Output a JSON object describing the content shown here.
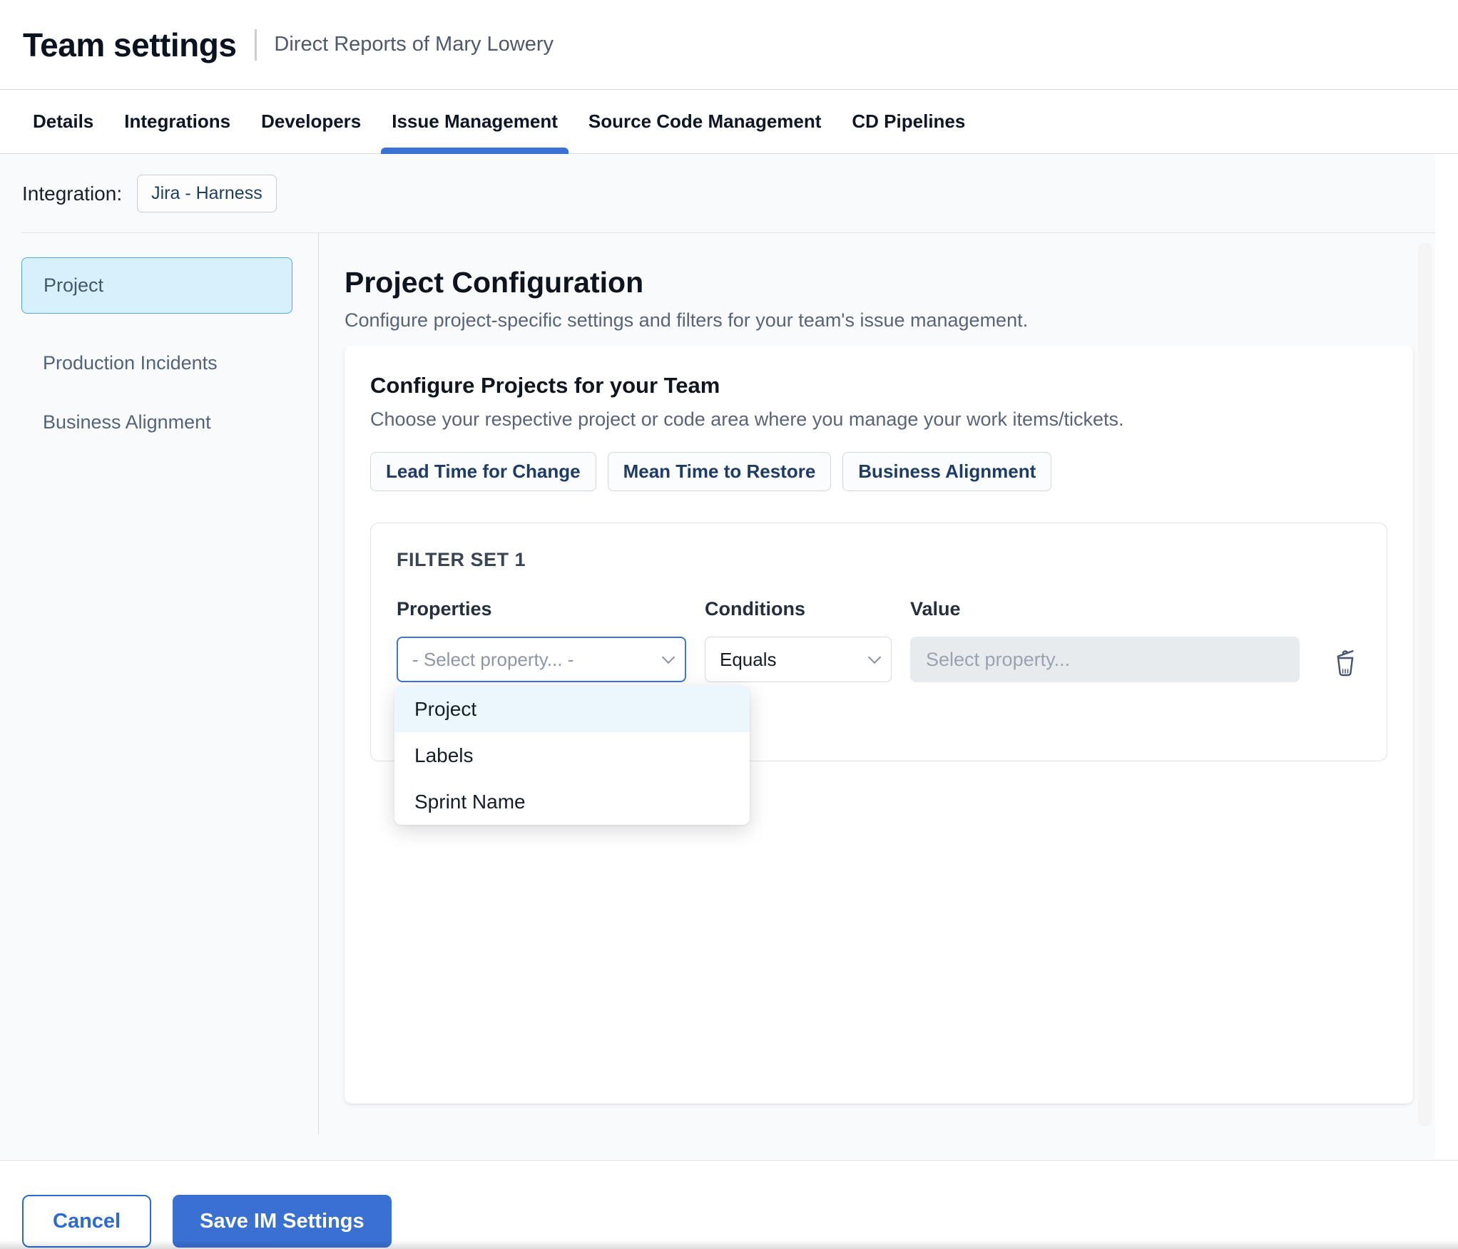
{
  "header": {
    "title": "Team settings",
    "subtitle": "Direct Reports of Mary Lowery"
  },
  "tabs": [
    {
      "label": "Details",
      "active": false
    },
    {
      "label": "Integrations",
      "active": false
    },
    {
      "label": "Developers",
      "active": false
    },
    {
      "label": "Issue Management",
      "active": true
    },
    {
      "label": "Source Code Management",
      "active": false
    },
    {
      "label": "CD Pipelines",
      "active": false
    }
  ],
  "integration": {
    "label": "Integration:",
    "chip": "Jira - Harness"
  },
  "sidebar": {
    "items": [
      {
        "label": "Project",
        "selected": true
      },
      {
        "label": "Production Incidents",
        "selected": false
      },
      {
        "label": "Business Alignment",
        "selected": false
      }
    ]
  },
  "main": {
    "heading": "Project Configuration",
    "description": "Configure project-specific settings and filters for your team's issue management.",
    "card": {
      "title": "Configure Projects for your Team",
      "description": "Choose your respective project or code area where you manage your work items/tickets.",
      "chips": [
        "Lead Time for Change",
        "Mean Time to Restore",
        "Business Alignment"
      ],
      "filter_set": {
        "title": "FILTER SET 1",
        "columns": [
          "Properties",
          "Conditions",
          "Value"
        ],
        "property_placeholder": "- Select property... -",
        "condition_value": "Equals",
        "value_placeholder": "Select property...",
        "dropdown_options": [
          {
            "label": "Project",
            "highlighted": true
          },
          {
            "label": "Labels",
            "highlighted": false
          },
          {
            "label": "Sprint Name",
            "highlighted": false
          }
        ]
      }
    }
  },
  "footer": {
    "cancel_label": "Cancel",
    "save_label": "Save IM Settings"
  },
  "colors": {
    "accent_blue": "#3b72d4",
    "selected_item_bg": "#d6f1fb",
    "selected_item_border": "#54a8da",
    "chip_text_navy": "#1e3c66",
    "disabled_input_bg": "#e8ebee",
    "page_bg": "#f8fafc"
  }
}
